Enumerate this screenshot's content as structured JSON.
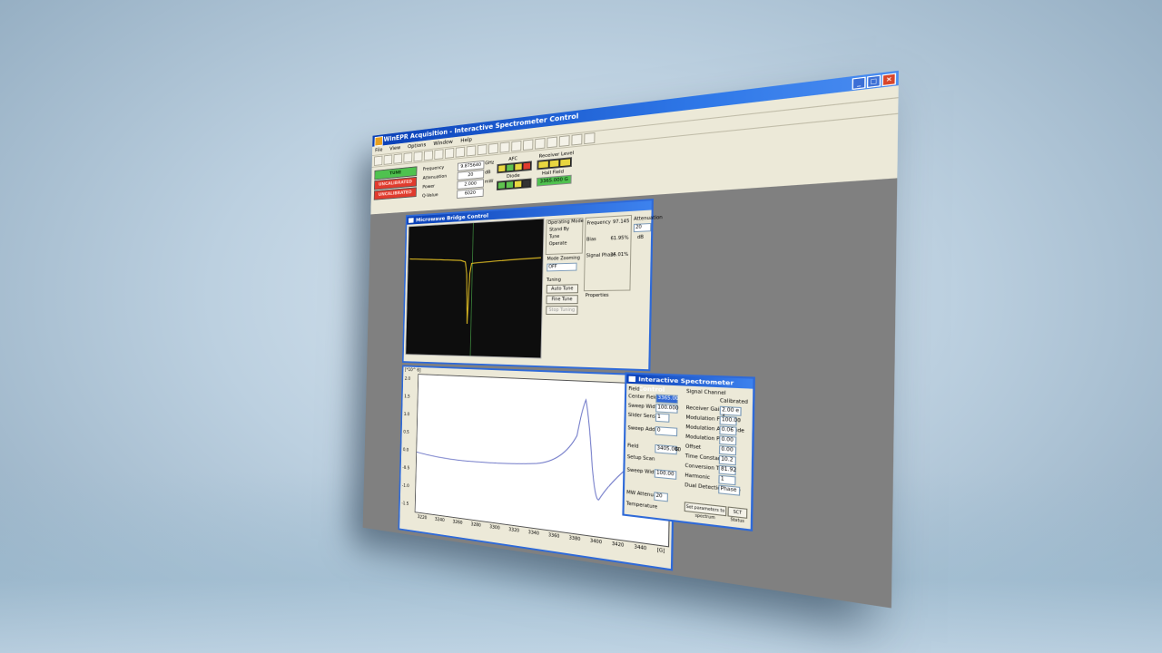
{
  "app": {
    "title": "WinEPR Acquisition - Interactive Spectrometer Control",
    "menu": [
      "File",
      "View",
      "Options",
      "Window",
      "Help"
    ]
  },
  "status": {
    "tune_label": "TUNE",
    "uncalibrated_1": "UNCALIBRATED",
    "uncalibrated_2": "UNCALIBRATED",
    "frequency_label": "Frequency",
    "frequency_value": "9.875640",
    "frequency_unit": "GHz",
    "attenuation_label": "Attenuation",
    "attenuation_value": "20",
    "attenuation_unit": "dB",
    "power_label": "Power",
    "power_value": "2.000",
    "power_unit": "mW",
    "q_label": "Q-Value",
    "q_value": "6020",
    "afc_label": "AFC",
    "diode_label": "Diode",
    "receiver_label": "Receiver Level",
    "hallfield_label": "Hall Field",
    "hallfield_value": "3365.000 G"
  },
  "bridge": {
    "title": "Microwave Bridge Control",
    "operating_mode_label": "Operating Mode",
    "modes": [
      "Stand By",
      "Tune",
      "Operate"
    ],
    "mode_zooming_label": "Mode Zooming",
    "mode_zooming_value": "OFF",
    "tuning_label": "Tuning",
    "auto_tune": "Auto Tune",
    "fine_tune": "Fine Tune",
    "stop_tuning": "Stop Tuning",
    "frequency_label": "Frequency",
    "frequency_value": "97.145",
    "bias_label": "Bias",
    "bias_value": "61.95%",
    "signal_phase_label": "Signal Phase",
    "signal_phase_value": "25.01%",
    "properties_label": "Properties",
    "attenuation_label": "Attenuation",
    "attenuation_value": "20",
    "attenuation_unit": "dB"
  },
  "isc": {
    "title": "Interactive Spectrometer Control",
    "field_group": "Field",
    "center_field_label": "Center Field",
    "center_field_value": "3365.00",
    "sweep_width_label": "Sweep Width",
    "sweep_width_value": "100.000",
    "slider_sensitivity_label": "Slider Sensitivity",
    "slider_sensitivity_value": "1",
    "sweep_address_label": "Sweep Address",
    "sweep_address_value": "0",
    "field_label": "Field",
    "field_value": "3405.000",
    "field_unit": "G",
    "setup_scan_label": "Setup Scan",
    "sweep_width_2_label": "Sweep Width",
    "sweep_width_2_value": "100.00",
    "mw_attenuator_label": "MW Attenuator",
    "mw_attenuator_value": "20",
    "temperature_label": "Temperature",
    "signal_channel_label": "Signal Channel",
    "calibrated_label": "Calibrated",
    "receiver_gain_label": "Receiver Gain",
    "receiver_gain_value": "2.00 e 4",
    "mod_freq_label": "Modulation Freq.",
    "mod_freq_value": "100.00",
    "mod_amp_label": "Modulation Amplitude",
    "mod_amp_value": "0.06",
    "mod_phase_label": "Modulation Phase",
    "mod_phase_value": "0.00",
    "offset_label": "Offset",
    "offset_value": "0.00",
    "time_const_label": "Time Constant",
    "time_const_value": "10.2",
    "conv_time_label": "Conversion Time",
    "conv_time_value": "81.92",
    "harmonic_label": "Harmonic",
    "harmonic_value": "1",
    "dual_det_label": "Dual Detection Mode",
    "dual_det_value": "Phase",
    "set_params_button": "Set parameters to spectrum",
    "sct_button": "SCT Status"
  },
  "plot": {
    "scale_label": "[*10^ 6]",
    "y_ticks": [
      "2.0",
      "1.5",
      "1.0",
      "0.5",
      "0.0",
      "-0.5",
      "-1.0",
      "-1.5"
    ],
    "x_ticks": [
      "3220",
      "3240",
      "3260",
      "3280",
      "3300",
      "3320",
      "3340",
      "3360",
      "3380",
      "3400",
      "3420",
      "3440"
    ],
    "x_unit": "[G]"
  },
  "colors": {
    "title_blue": "#0a3fb6",
    "trace_blue": "#6b74c6",
    "scope_yellow": "#d9b722",
    "ok_green": "#4fc24f",
    "warn_red": "#e03b2e"
  }
}
